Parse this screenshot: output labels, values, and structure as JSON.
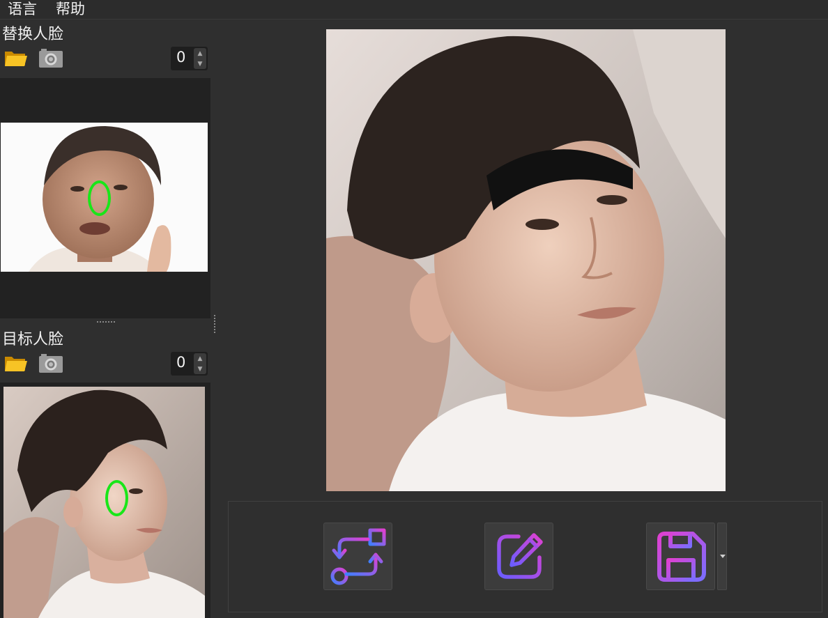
{
  "menu": {
    "language": "语言",
    "help": "帮助"
  },
  "source_section": {
    "title": "替换人脸",
    "count": "0"
  },
  "target_section": {
    "title": "目标人脸",
    "count": "0"
  },
  "toolbar_icons": [
    "folder-open-icon",
    "camera-icon"
  ],
  "preview": {
    "image": "face-swapped-result"
  },
  "actions": [
    "swap-faces",
    "edit",
    "save"
  ],
  "colors": {
    "marker": "#19e619",
    "gradient_start": "#3f7fff",
    "gradient_end": "#e040d0",
    "folder": "#f4b400"
  }
}
